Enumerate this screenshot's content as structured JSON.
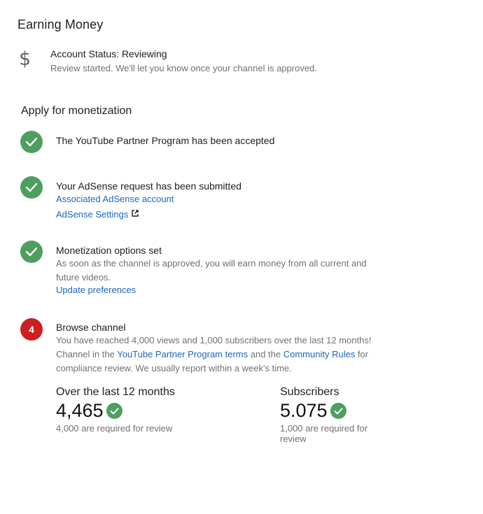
{
  "page": {
    "title": "Earning Money"
  },
  "account": {
    "icon": "dollar-icon",
    "status": "Account Status: Reviewing",
    "description": "Review started. We'll let you know once your channel is approved."
  },
  "monetization": {
    "heading": "Apply for monetization",
    "steps": [
      {
        "status": "done",
        "title": "The YouTube Partner Program has been accepted"
      },
      {
        "status": "done",
        "title": "Your AdSense request has been submitted",
        "links": [
          "Associated AdSense account",
          "AdSense Settings"
        ]
      },
      {
        "status": "done",
        "title": "Monetization options set",
        "description_line1": "As soon as the channel is approved, you will earn money from all current and",
        "description_line2": "future videos.",
        "link": "Update preferences"
      },
      {
        "status": "pending",
        "number": "4",
        "title": "Browse channel",
        "line1": "You have reached 4,000 views and 1,000 subscribers over the last 12 months!",
        "line2_prefix": "Channel in the ",
        "line2_link1": "YouTube Partner Program terms",
        "line2_mid": " and the ",
        "line2_link2": "Community Rules",
        "line2_suffix": " for",
        "line3": "compliance review. We usually report within a week's time."
      }
    ]
  },
  "stats": {
    "views": {
      "label": "Over the last 12 months",
      "value": "4,465",
      "requirement": "4,000 are required for review"
    },
    "subscribers": {
      "label": "Subscribers",
      "value": "5.075",
      "requirement_line1": "1,000 are required for",
      "requirement_line2": "review"
    }
  },
  "colors": {
    "success": "#4e9f5f",
    "alert": "#cc1f1f",
    "link": "#1a66c0"
  }
}
